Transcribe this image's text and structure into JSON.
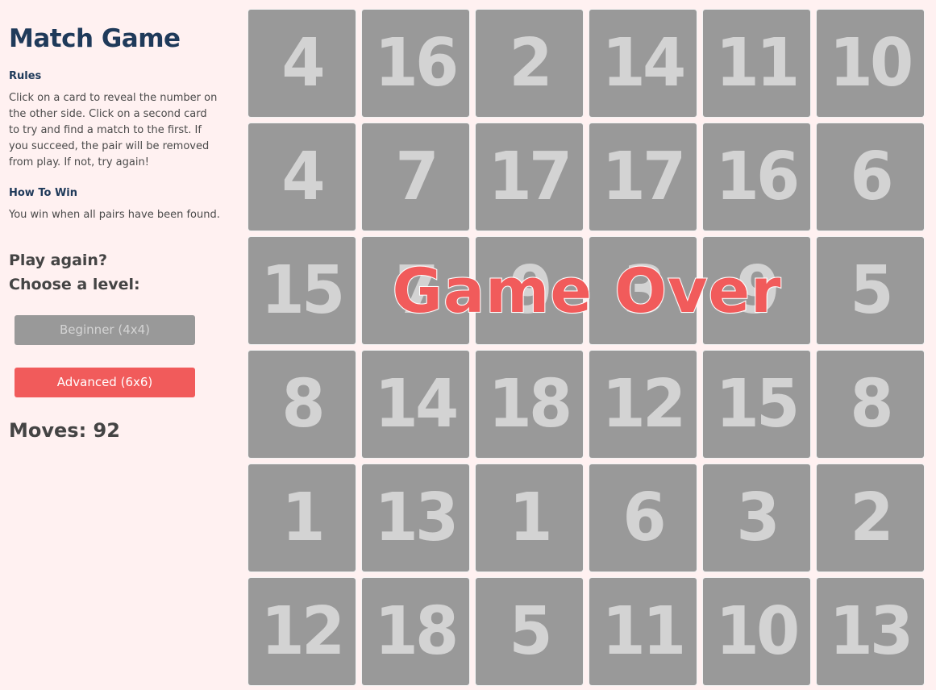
{
  "sidebar": {
    "title": "Match Game",
    "rules_heading": "Rules",
    "rules_text": "Click on a card to reveal the number on the other side. Click on a second card to try and find a match to the first. If you succeed, the pair will be removed from play. If not, try again!",
    "how_to_win_heading": "How To Win",
    "how_to_win_text": "You win when all pairs have been found.",
    "play_again_line1": "Play again?",
    "play_again_line2": "Choose a level:",
    "beginner_label": "Beginner (4x4)",
    "advanced_label": "Advanced (6x6)",
    "moves_label": "Moves: 92"
  },
  "board": {
    "rows": [
      [
        "4",
        "16",
        "2",
        "14",
        "11",
        "10"
      ],
      [
        "4",
        "7",
        "17",
        "17",
        "16",
        "6"
      ],
      [
        "15",
        "7",
        "9",
        "3",
        "9",
        "5"
      ],
      [
        "8",
        "14",
        "18",
        "12",
        "15",
        "8"
      ],
      [
        "1",
        "13",
        "1",
        "6",
        "3",
        "2"
      ],
      [
        "12",
        "18",
        "5",
        "11",
        "10",
        "13"
      ]
    ]
  },
  "overlay": {
    "message": "Game Over"
  },
  "colors": {
    "accent": "#f15b5b",
    "card": "#999999",
    "card_text": "#d3d3d3",
    "title": "#1f3a5a",
    "background": "#fff1f1"
  }
}
